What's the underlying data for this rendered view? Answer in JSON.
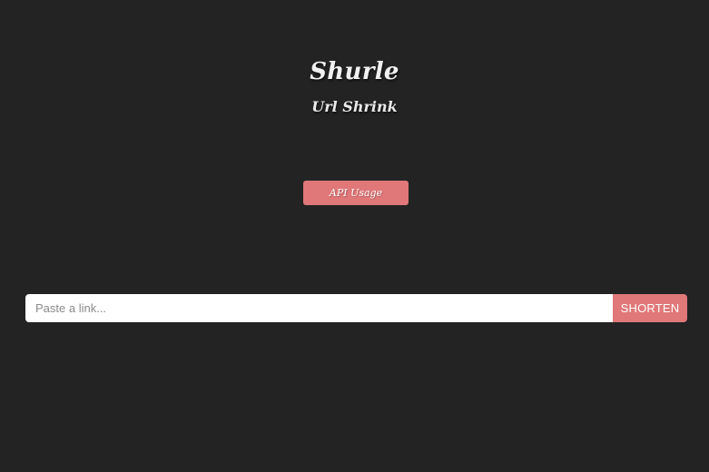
{
  "header": {
    "title": "Shurle",
    "subtitle": "Url Shrink"
  },
  "api_button": {
    "label": "API Usage"
  },
  "shorten_form": {
    "input_placeholder": "Paste a link...",
    "input_value": "",
    "submit_label": "SHORTEN"
  },
  "colors": {
    "background": "#232323",
    "accent": "#e07778",
    "text": "#f1f1f1",
    "input_background": "#ffffff"
  }
}
